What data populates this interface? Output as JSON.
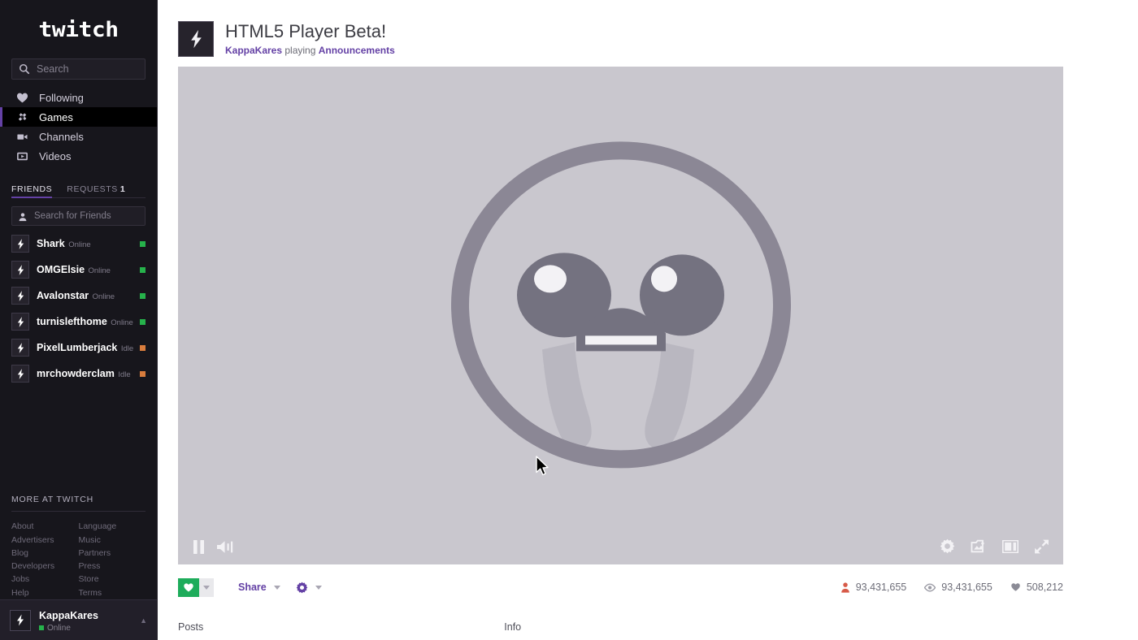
{
  "sidebar": {
    "logo": "twitch",
    "search": {
      "placeholder": "Search",
      "value": "",
      "icon": "search-icon"
    },
    "nav": [
      {
        "label": "Following",
        "icon": "heart-icon",
        "active": false
      },
      {
        "label": "Games",
        "icon": "gamepad-icon",
        "active": true
      },
      {
        "label": "Channels",
        "icon": "video-camera-icon",
        "active": false
      },
      {
        "label": "Videos",
        "icon": "play-box-icon",
        "active": false
      }
    ],
    "friends": {
      "tab_friends": "FRIENDS",
      "tab_requests": "REQUESTS",
      "requests_count": "1",
      "search_placeholder": "Search for Friends",
      "search_value": "",
      "search_icon": "person-icon",
      "list": [
        {
          "name": "Shark",
          "status": "Online",
          "color": "#26b24b"
        },
        {
          "name": "OMGElsie",
          "status": "Online",
          "color": "#26b24b"
        },
        {
          "name": "Avalonstar",
          "status": "Online",
          "color": "#26b24b"
        },
        {
          "name": "turnislefthome",
          "status": "Online",
          "color": "#26b24b"
        },
        {
          "name": "PixelLumberjack",
          "status": "Idle",
          "color": "#d97d3d"
        },
        {
          "name": "mrchowderclam",
          "status": "Idle",
          "color": "#d97d3d"
        }
      ]
    },
    "more": {
      "title": "MORE AT TWITCH",
      "col1": [
        "About",
        "Advertisers",
        "Blog",
        "Developers",
        "Jobs",
        "Help"
      ],
      "col2": [
        "Language",
        "Music",
        "Partners",
        "Press",
        "Store",
        "Terms"
      ]
    },
    "user": {
      "name": "KappaKares",
      "status": "Online",
      "caret": "▲"
    }
  },
  "header": {
    "title": "HTML5 Player Beta!",
    "channel": "KappaKares",
    "playing_text": " playing ",
    "game": "Announcements"
  },
  "player": {
    "emote_name": "bible-thump-emote",
    "controls_left": [
      {
        "name": "pause-button",
        "icon": "pause-icon"
      },
      {
        "name": "volume-button",
        "icon": "volume-icon"
      }
    ],
    "controls_right": [
      {
        "name": "settings-button",
        "icon": "gear-icon"
      },
      {
        "name": "clip-button",
        "icon": "clip-icon"
      },
      {
        "name": "theater-mode-button",
        "icon": "theater-icon"
      },
      {
        "name": "fullscreen-button",
        "icon": "fullscreen-icon"
      }
    ]
  },
  "actions": {
    "follow_label": "Follow",
    "share_label": "Share",
    "follow_color": "#1eac5b",
    "accent_color": "#6441a5",
    "stats": [
      {
        "name": "viewers",
        "icon": "viewer-icon",
        "value": "93,431,655",
        "color": "#d75a48"
      },
      {
        "name": "views",
        "icon": "eye-icon",
        "value": "93,431,655",
        "color": "#9b9ba5"
      },
      {
        "name": "followers",
        "icon": "heart-icon",
        "value": "508,212",
        "color": "#8b8b96"
      }
    ]
  },
  "tabs": [
    {
      "label": "Posts",
      "name": "tab-posts"
    },
    {
      "label": "Info",
      "name": "tab-info"
    }
  ]
}
